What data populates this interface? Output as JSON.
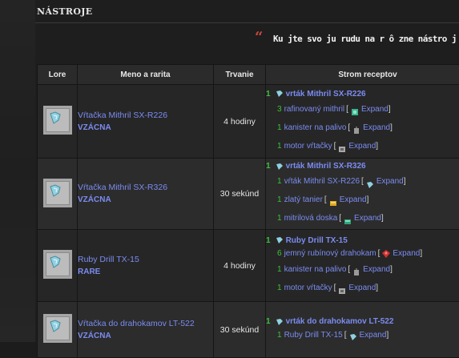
{
  "section": {
    "title": "NÁSTROJE"
  },
  "quote": {
    "mark": "“",
    "text": "Ku jte svo ju rudu na r ô zne nástro j"
  },
  "table": {
    "headers": [
      "Lore",
      "Meno a rarita",
      "Trvanie",
      "Strom receptov"
    ],
    "expand_label": "Expand",
    "rows": [
      {
        "name": "Vŕtačka Mithril SX-R226",
        "rarity": "VZÁCNA",
        "duration": "4 hodiny",
        "recipe": {
          "qty": "1",
          "item": "vrták Mithril SX-R226",
          "icon": "drill-icon",
          "ingredients": [
            {
              "qty": "3",
              "item": "rafinovaný mithril",
              "icon": "mithril-icon"
            },
            {
              "qty": "1",
              "item": "kanister na palivo",
              "icon": "canister-icon"
            },
            {
              "qty": "1",
              "item": "motor vŕtačky",
              "icon": "engine-icon"
            }
          ]
        }
      },
      {
        "name": "Vŕtačka Mithril SX-R326",
        "rarity": "VZÁCNA",
        "duration": "30 sekúnd",
        "recipe": {
          "qty": "1",
          "item": "vrták Mithril SX-R326",
          "icon": "drill-icon",
          "ingredients": [
            {
              "qty": "1",
              "item": "vŕták Mithril SX-R226",
              "icon": "drill-icon"
            },
            {
              "qty": "1",
              "item": "zlatý tanier",
              "icon": "gold-plate-icon"
            },
            {
              "qty": "1",
              "item": "mitrilová doska",
              "icon": "mithril-plate-icon"
            }
          ]
        }
      },
      {
        "name": "Ruby Drill TX-15",
        "rarity": "RARE",
        "duration": "4 hodiny",
        "recipe": {
          "qty": "1",
          "item": "Ruby Drill TX-15",
          "icon": "drill-icon",
          "ingredients": [
            {
              "qty": "6",
              "item": "jemný rubínový drahokam",
              "icon": "ruby-icon"
            },
            {
              "qty": "1",
              "item": "kanister na palivo",
              "icon": "canister-icon"
            },
            {
              "qty": "1",
              "item": "motor vŕtačky",
              "icon": "engine-icon"
            }
          ]
        }
      },
      {
        "name": "Vŕtačka do drahokamov LT-522",
        "rarity": "VZÁCNA",
        "duration": "30 sekúnd",
        "recipe": {
          "qty": "1",
          "item": "vrták do drahokamov LT-522",
          "icon": "drill-icon",
          "ingredients": [
            {
              "qty": "1",
              "item": "Ruby Drill TX-15",
              "icon": "drill-icon"
            }
          ]
        }
      }
    ]
  },
  "colors": {
    "link": "#7b8cf0",
    "quantity": "#3ec03e",
    "quote_mark": "#c9473f",
    "header_bg": "#2b2b2b"
  }
}
